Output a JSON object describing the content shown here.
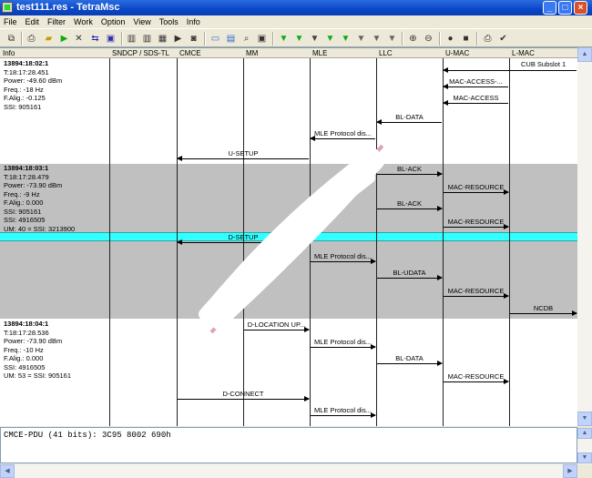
{
  "window": {
    "title": "test111.res - TetraMsc"
  },
  "menu": [
    "File",
    "Edit",
    "Filter",
    "Work",
    "Option",
    "View",
    "Tools",
    "Info"
  ],
  "toolbar_icons": [
    "copy-icon",
    "print-icon",
    "open-icon",
    "run-icon",
    "stop-icon",
    "export-icon",
    "save-icon",
    "column-icon",
    "column-icon",
    "grid-icon",
    "play-icon",
    "record-icon",
    "view-icon",
    "window-icon",
    "search-icon",
    "page-icon",
    "filter-icon",
    "filter-icon",
    "filter-icon",
    "filter-icon",
    "filter-icon",
    "filter-icon",
    "filter-icon",
    "lock-icon",
    "unlock-icon",
    "stop-icon",
    "square-icon",
    "printer-icon",
    "check-icon"
  ],
  "columns": [
    "Info",
    "SNDCP / SDS-TL",
    "CMCE",
    "MM",
    "MLE",
    "LLC",
    "U-MAC",
    "L-MAC"
  ],
  "blocks": [
    {
      "lines": [
        "13894:18:02:1",
        "T:18:17:28.451",
        "Power: -49.60 dBm",
        "Freq.: -18 Hz",
        "F.Alig.: -0.125",
        "SSI: 905161"
      ]
    },
    {
      "lines": [
        "13894:18:03:1",
        "T:18:17:28.479",
        "Power: -73.90 dBm",
        "Freq.: -9 Hz",
        "F.Alig.: 0.000",
        "SSI: 905161",
        "SSI: 4916505",
        "UM: 40 = SSI: 3213900"
      ]
    },
    {
      "lines": [
        "13894:18:04:1",
        "T:18:17:28.536",
        "Power: -73.90 dBm",
        "Freq.: -10 Hz",
        "F.Alig.: 0.000",
        "SSI: 4916505",
        "UM: 53 = SSI: 905161"
      ]
    }
  ],
  "lmac_label": "CUB Subslot 1",
  "messages": [
    {
      "label": "MAC-ACCESS-..."
    },
    {
      "label": "MAC-ACCESS"
    },
    {
      "label": "BL-DATA"
    },
    {
      "label": "MLE Protocol dis..."
    },
    {
      "label": "U-SETUP"
    },
    {
      "label": "BL-ACK"
    },
    {
      "label": "MAC-RESOURCE"
    },
    {
      "label": "BL-ACK"
    },
    {
      "label": "MAC-RESOURCE"
    },
    {
      "label": "D-SETUP"
    },
    {
      "label": "MLE Protocol dis..."
    },
    {
      "label": "BL-UDATA"
    },
    {
      "label": "MAC-RESOURCE"
    },
    {
      "label": "NCDB"
    },
    {
      "label": "D-LOCATION UP..."
    },
    {
      "label": "MLE Protocol dis..."
    },
    {
      "label": "BL-DATA"
    },
    {
      "label": "MAC-RESOURCE"
    },
    {
      "label": "D-CONNECT"
    },
    {
      "label": "MLE Protocol dis..."
    }
  ],
  "detail": "CMCE-PDU (41 bits): 3C95 8002 690h",
  "colors": {
    "gray_band": "#c0c0c0",
    "highlight": "#33ffff"
  }
}
